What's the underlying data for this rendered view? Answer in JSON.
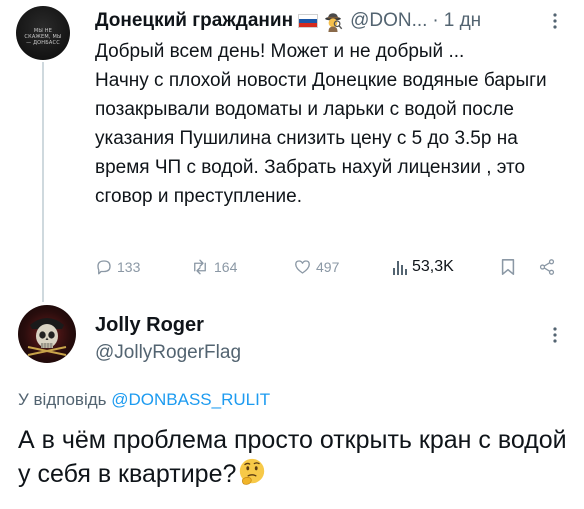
{
  "parent_tweet": {
    "author_name": "Донецкий гражданин",
    "handle": "@DON...",
    "separator": "·",
    "time": "1 дн",
    "avatar_text": "МЫ НЕ СКАЖЕМ, МЫ — ДОНБАСС",
    "text": "Добрый всем день! Может и не добрый ...\nНачну с плохой новости  Донецкие водяные барыги позакрывали водоматы  и ларьки с водой  после указания Пушилина снизить цену с 5 до 3.5р на время  ЧП с водой. Забрать нахуй лицензии , это сговор и преступление.",
    "stats": {
      "replies": "133",
      "reposts": "164",
      "likes": "497",
      "views": "53,3K"
    },
    "badges": [
      "russia-flag",
      "detective-emoji"
    ]
  },
  "reply_tweet": {
    "author_name": "Jolly Roger",
    "handle": "@JollyRogerFlag",
    "reply_prefix": "У відповідь",
    "reply_to": "@DONBASS_RULIT",
    "text": "А в чём проблема просто открыть кран с водой у себя в квартире?",
    "emoji": "thinking-face"
  },
  "colors": {
    "text": "#0f1419",
    "muted": "#536471",
    "action_gray": "#8b98a5",
    "link": "#1d9bf0",
    "thread_line": "#cfd9de"
  }
}
